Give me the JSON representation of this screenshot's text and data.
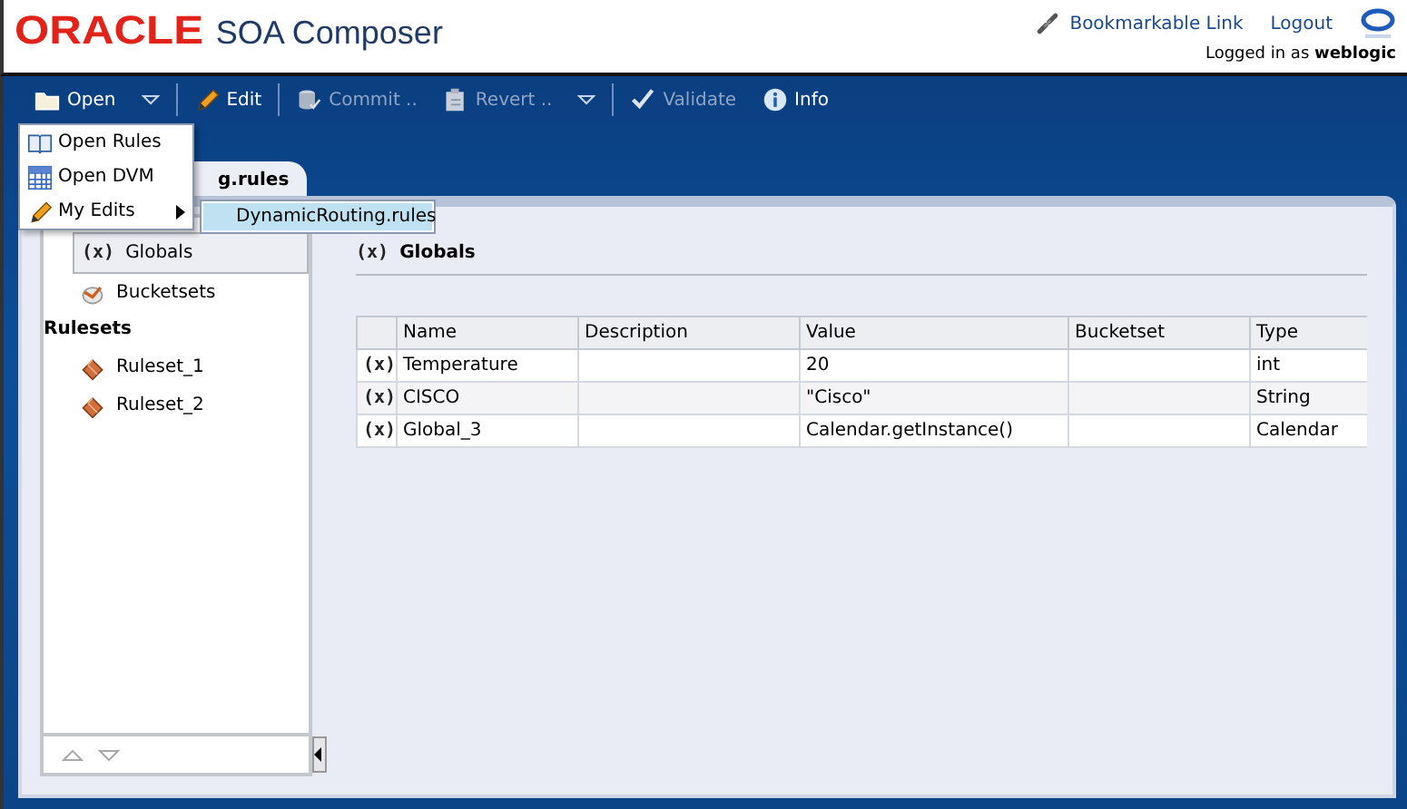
{
  "header": {
    "logo": "ORACLE",
    "app_title": "SOA Composer",
    "links": [
      {
        "label": "Bookmarkable Link",
        "kind": "chain"
      },
      {
        "label": "Logout",
        "kind": "plain"
      }
    ],
    "login": "Logged in as **weblogic**"
  },
  "toolbar": [
    {
      "label": "Open",
      "kind": "folder",
      "disabled": false,
      "dropdown": true
    },
    {
      "label": "Edit",
      "kind": "pencil",
      "disabled": false,
      "dropdown": false
    },
    {
      "label": "Commit ..",
      "kind": "commit",
      "disabled": true,
      "dropdown": false
    },
    {
      "label": "Revert ..",
      "kind": "revert",
      "disabled": true,
      "dropdown": true
    },
    {
      "label": "Validate",
      "kind": "check",
      "disabled": true,
      "dropdown": false
    },
    {
      "label": "Info",
      "kind": "info",
      "disabled": false,
      "dropdown": false
    }
  ],
  "open_menu": {
    "items": [
      {
        "label": "Open Rules",
        "kind": "book",
        "submenu": false
      },
      {
        "label": "Open DVM",
        "kind": "grid",
        "submenu": false
      },
      {
        "label": "My Edits",
        "kind": "pencil",
        "submenu": true
      }
    ],
    "submenu": [
      {
        "label": "DynamicRouting.rules",
        "selected": true
      }
    ]
  },
  "document_tab": {
    "label": "g.rules",
    "selected": true
  },
  "sidebar": {
    "items": [
      {
        "label": "Globals",
        "marker": "(x)",
        "selected": true
      },
      {
        "label": "Bucketsets",
        "marker": "",
        "selected": false
      }
    ],
    "section": "Rulesets",
    "rulesets": [
      {
        "label": "Ruleset_1",
        "selected": false
      },
      {
        "label": "Ruleset_2",
        "selected": false
      }
    ]
  },
  "content": {
    "marker": "(x)",
    "title": "Globals",
    "table": {
      "columns": [
        "Name",
        "Description",
        "Value",
        "Bucketset",
        "Type"
      ],
      "rows": [
        {
          "marker": "(x)",
          "cells": [
            "Temperature",
            "",
            "20",
            "",
            "int"
          ]
        },
        {
          "marker": "(x)",
          "cells": [
            "CISCO",
            "",
            "\"Cisco\"",
            "",
            "String"
          ]
        },
        {
          "marker": "(x)",
          "cells": [
            "Global_3",
            "",
            "Calendar.getInstance()",
            "",
            "Calendar"
          ]
        }
      ]
    }
  }
}
